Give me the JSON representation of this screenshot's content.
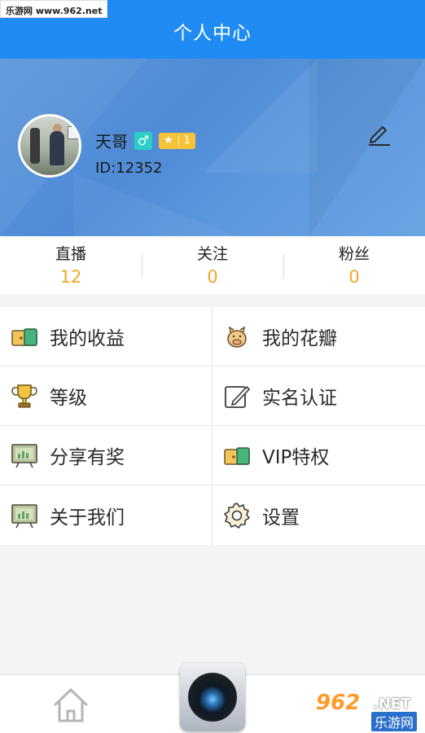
{
  "watermark": {
    "top_text": "乐游网 www.962.net",
    "bottom_logo": "962",
    "bottom_net": ".NET",
    "bottom_cn": "乐游网"
  },
  "header": {
    "title": "个人中心"
  },
  "profile": {
    "name": "天哥",
    "gender_symbol": "♂",
    "level": "1",
    "level_star": "★",
    "user_id": "ID:12352"
  },
  "stats": [
    {
      "label": "直播",
      "value": "12"
    },
    {
      "label": "关注",
      "value": "0"
    },
    {
      "label": "粉丝",
      "value": "0"
    }
  ],
  "menu": [
    {
      "label": "我的收益",
      "icon": "wallet-icon"
    },
    {
      "label": "我的花瓣",
      "icon": "piggy-bank-icon"
    },
    {
      "label": "等级",
      "icon": "trophy-icon"
    },
    {
      "label": "实名认证",
      "icon": "edit-document-icon"
    },
    {
      "label": "分享有奖",
      "icon": "presentation-board-icon"
    },
    {
      "label": "VIP特权",
      "icon": "wallet-icon"
    },
    {
      "label": "关于我们",
      "icon": "presentation-board-icon"
    },
    {
      "label": "设置",
      "icon": "gear-icon"
    }
  ],
  "colors": {
    "header": "#1f8bf3",
    "stat_value": "#f5a623",
    "gender": "#2ccfc6",
    "level_badge": "#f6c338"
  }
}
